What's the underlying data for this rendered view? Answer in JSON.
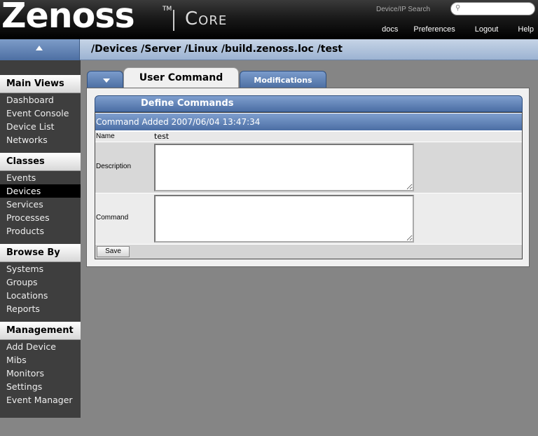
{
  "header": {
    "logo": "Zenoss",
    "trademark": "TM",
    "product": "Core",
    "search_label": "Device/IP Search",
    "search_placeholder": "",
    "links": [
      "docs",
      "Preferences",
      "Logout",
      "Help"
    ]
  },
  "breadcrumb": "/Devices /Server /Linux /build.zenoss.loc /test",
  "sidebar": {
    "sections": [
      {
        "title": "Main Views",
        "items": [
          "Dashboard",
          "Event Console",
          "Device List",
          "Networks"
        ]
      },
      {
        "title": "Classes",
        "items": [
          "Events",
          "Devices",
          "Services",
          "Processes",
          "Products"
        ]
      },
      {
        "title": "Browse By",
        "items": [
          "Systems",
          "Groups",
          "Locations",
          "Reports"
        ]
      },
      {
        "title": "Management",
        "items": [
          "Add Device",
          "Mibs",
          "Monitors",
          "Settings",
          "Event Manager"
        ]
      }
    ],
    "active_item": "Devices"
  },
  "tabs": {
    "active": "User Command",
    "other": "Modifications"
  },
  "panel": {
    "title": "Define Commands",
    "message": "Command Added 2007/06/04 13:47:34",
    "name_label": "Name",
    "name_value": "test",
    "description_label": "Description",
    "description_value": "",
    "command_label": "Command",
    "command_value": "",
    "save_label": "Save"
  }
}
